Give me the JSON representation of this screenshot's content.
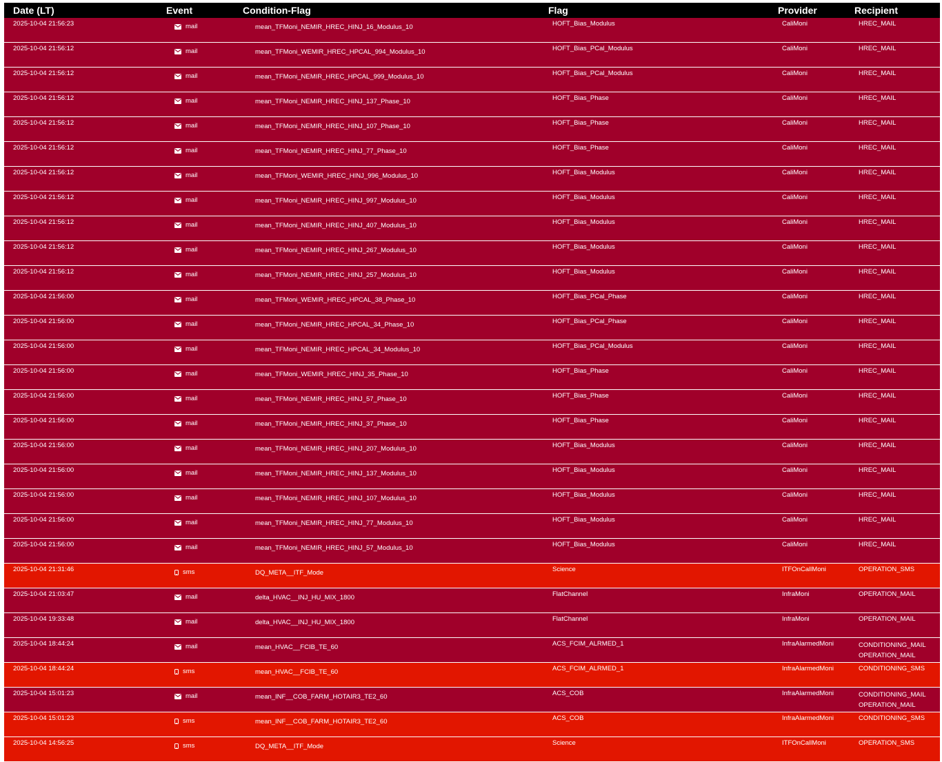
{
  "header": {
    "date": "Date (LT)",
    "event": "Event",
    "condition": "Condition-Flag",
    "flag": "Flag",
    "provider": "Provider",
    "recipient": "Recipient"
  },
  "colors": {
    "header_bg": "#000000",
    "mail_row": "#a0002a",
    "sms_row": "#e21600"
  },
  "rows": [
    {
      "date": "2025-10-04 21:56:23",
      "event": "mail",
      "icon": "envelope-icon",
      "condition": "mean_TFMoni_NEMIR_HREC_HINJ_16_Modulus_10",
      "flag": "HOFT_Bias_Modulus",
      "provider": "CaliMoni",
      "recipient": [
        "HREC_MAIL"
      ]
    },
    {
      "date": "2025-10-04 21:56:12",
      "event": "mail",
      "icon": "envelope-icon",
      "condition": "mean_TFMoni_WEMIR_HREC_HPCAL_994_Modulus_10",
      "flag": "HOFT_Bias_PCal_Modulus",
      "provider": "CaliMoni",
      "recipient": [
        "HREC_MAIL"
      ]
    },
    {
      "date": "2025-10-04 21:56:12",
      "event": "mail",
      "icon": "envelope-icon",
      "condition": "mean_TFMoni_NEMIR_HREC_HPCAL_999_Modulus_10",
      "flag": "HOFT_Bias_PCal_Modulus",
      "provider": "CaliMoni",
      "recipient": [
        "HREC_MAIL"
      ]
    },
    {
      "date": "2025-10-04 21:56:12",
      "event": "mail",
      "icon": "envelope-icon",
      "condition": "mean_TFMoni_NEMIR_HREC_HINJ_137_Phase_10",
      "flag": "HOFT_Bias_Phase",
      "provider": "CaliMoni",
      "recipient": [
        "HREC_MAIL"
      ]
    },
    {
      "date": "2025-10-04 21:56:12",
      "event": "mail",
      "icon": "envelope-icon",
      "condition": "mean_TFMoni_NEMIR_HREC_HINJ_107_Phase_10",
      "flag": "HOFT_Bias_Phase",
      "provider": "CaliMoni",
      "recipient": [
        "HREC_MAIL"
      ]
    },
    {
      "date": "2025-10-04 21:56:12",
      "event": "mail",
      "icon": "envelope-icon",
      "condition": "mean_TFMoni_NEMIR_HREC_HINJ_77_Phase_10",
      "flag": "HOFT_Bias_Phase",
      "provider": "CaliMoni",
      "recipient": [
        "HREC_MAIL"
      ]
    },
    {
      "date": "2025-10-04 21:56:12",
      "event": "mail",
      "icon": "envelope-icon",
      "condition": "mean_TFMoni_WEMIR_HREC_HINJ_996_Modulus_10",
      "flag": "HOFT_Bias_Modulus",
      "provider": "CaliMoni",
      "recipient": [
        "HREC_MAIL"
      ]
    },
    {
      "date": "2025-10-04 21:56:12",
      "event": "mail",
      "icon": "envelope-icon",
      "condition": "mean_TFMoni_NEMIR_HREC_HINJ_997_Modulus_10",
      "flag": "HOFT_Bias_Modulus",
      "provider": "CaliMoni",
      "recipient": [
        "HREC_MAIL"
      ]
    },
    {
      "date": "2025-10-04 21:56:12",
      "event": "mail",
      "icon": "envelope-icon",
      "condition": "mean_TFMoni_NEMIR_HREC_HINJ_407_Modulus_10",
      "flag": "HOFT_Bias_Modulus",
      "provider": "CaliMoni",
      "recipient": [
        "HREC_MAIL"
      ]
    },
    {
      "date": "2025-10-04 21:56:12",
      "event": "mail",
      "icon": "envelope-icon",
      "condition": "mean_TFMoni_NEMIR_HREC_HINJ_267_Modulus_10",
      "flag": "HOFT_Bias_Modulus",
      "provider": "CaliMoni",
      "recipient": [
        "HREC_MAIL"
      ]
    },
    {
      "date": "2025-10-04 21:56:12",
      "event": "mail",
      "icon": "envelope-icon",
      "condition": "mean_TFMoni_NEMIR_HREC_HINJ_257_Modulus_10",
      "flag": "HOFT_Bias_Modulus",
      "provider": "CaliMoni",
      "recipient": [
        "HREC_MAIL"
      ]
    },
    {
      "date": "2025-10-04 21:56:00",
      "event": "mail",
      "icon": "envelope-icon",
      "condition": "mean_TFMoni_WEMIR_HREC_HPCAL_38_Phase_10",
      "flag": "HOFT_Bias_PCal_Phase",
      "provider": "CaliMoni",
      "recipient": [
        "HREC_MAIL"
      ]
    },
    {
      "date": "2025-10-04 21:56:00",
      "event": "mail",
      "icon": "envelope-icon",
      "condition": "mean_TFMoni_NEMIR_HREC_HPCAL_34_Phase_10",
      "flag": "HOFT_Bias_PCal_Phase",
      "provider": "CaliMoni",
      "recipient": [
        "HREC_MAIL"
      ]
    },
    {
      "date": "2025-10-04 21:56:00",
      "event": "mail",
      "icon": "envelope-icon",
      "condition": "mean_TFMoni_NEMIR_HREC_HPCAL_34_Modulus_10",
      "flag": "HOFT_Bias_PCal_Modulus",
      "provider": "CaliMoni",
      "recipient": [
        "HREC_MAIL"
      ]
    },
    {
      "date": "2025-10-04 21:56:00",
      "event": "mail",
      "icon": "envelope-icon",
      "condition": "mean_TFMoni_WEMIR_HREC_HINJ_35_Phase_10",
      "flag": "HOFT_Bias_Phase",
      "provider": "CaliMoni",
      "recipient": [
        "HREC_MAIL"
      ]
    },
    {
      "date": "2025-10-04 21:56:00",
      "event": "mail",
      "icon": "envelope-icon",
      "condition": "mean_TFMoni_NEMIR_HREC_HINJ_57_Phase_10",
      "flag": "HOFT_Bias_Phase",
      "provider": "CaliMoni",
      "recipient": [
        "HREC_MAIL"
      ]
    },
    {
      "date": "2025-10-04 21:56:00",
      "event": "mail",
      "icon": "envelope-icon",
      "condition": "mean_TFMoni_NEMIR_HREC_HINJ_37_Phase_10",
      "flag": "HOFT_Bias_Phase",
      "provider": "CaliMoni",
      "recipient": [
        "HREC_MAIL"
      ]
    },
    {
      "date": "2025-10-04 21:56:00",
      "event": "mail",
      "icon": "envelope-icon",
      "condition": "mean_TFMoni_NEMIR_HREC_HINJ_207_Modulus_10",
      "flag": "HOFT_Bias_Modulus",
      "provider": "CaliMoni",
      "recipient": [
        "HREC_MAIL"
      ]
    },
    {
      "date": "2025-10-04 21:56:00",
      "event": "mail",
      "icon": "envelope-icon",
      "condition": "mean_TFMoni_NEMIR_HREC_HINJ_137_Modulus_10",
      "flag": "HOFT_Bias_Modulus",
      "provider": "CaliMoni",
      "recipient": [
        "HREC_MAIL"
      ]
    },
    {
      "date": "2025-10-04 21:56:00",
      "event": "mail",
      "icon": "envelope-icon",
      "condition": "mean_TFMoni_NEMIR_HREC_HINJ_107_Modulus_10",
      "flag": "HOFT_Bias_Modulus",
      "provider": "CaliMoni",
      "recipient": [
        "HREC_MAIL"
      ]
    },
    {
      "date": "2025-10-04 21:56:00",
      "event": "mail",
      "icon": "envelope-icon",
      "condition": "mean_TFMoni_NEMIR_HREC_HINJ_77_Modulus_10",
      "flag": "HOFT_Bias_Modulus",
      "provider": "CaliMoni",
      "recipient": [
        "HREC_MAIL"
      ]
    },
    {
      "date": "2025-10-04 21:56:00",
      "event": "mail",
      "icon": "envelope-icon",
      "condition": "mean_TFMoni_NEMIR_HREC_HINJ_57_Modulus_10",
      "flag": "HOFT_Bias_Modulus",
      "provider": "CaliMoni",
      "recipient": [
        "HREC_MAIL"
      ]
    },
    {
      "date": "2025-10-04 21:31:46",
      "event": "sms",
      "icon": "mobile-phone-icon",
      "condition": "DQ_META__ITF_Mode",
      "flag": "Science",
      "provider": "ITFOnCallMoni",
      "recipient": [
        "OPERATION_SMS"
      ]
    },
    {
      "date": "2025-10-04 21:03:47",
      "event": "mail",
      "icon": "envelope-icon",
      "condition": "delta_HVAC__INJ_HU_MIX_1800",
      "flag": "FlatChannel",
      "provider": "InfraMoni",
      "recipient": [
        "OPERATION_MAIL"
      ]
    },
    {
      "date": "2025-10-04 19:33:48",
      "event": "mail",
      "icon": "envelope-icon",
      "condition": "delta_HVAC__INJ_HU_MIX_1800",
      "flag": "FlatChannel",
      "provider": "InfraMoni",
      "recipient": [
        "OPERATION_MAIL"
      ]
    },
    {
      "date": "2025-10-04 18:44:24",
      "event": "mail",
      "icon": "envelope-icon",
      "condition": "mean_HVAC__FCIB_TE_60",
      "flag": "ACS_FCIM_ALRMED_1",
      "provider": "InfraAlarmedMoni",
      "recipient": [
        "CONDITIONING_MAIL",
        "OPERATION_MAIL"
      ]
    },
    {
      "date": "2025-10-04 18:44:24",
      "event": "sms",
      "icon": "mobile-phone-icon",
      "condition": "mean_HVAC__FCIB_TE_60",
      "flag": "ACS_FCIM_ALRMED_1",
      "provider": "InfraAlarmedMoni",
      "recipient": [
        "CONDITIONING_SMS"
      ]
    },
    {
      "date": "2025-10-04 15:01:23",
      "event": "mail",
      "icon": "envelope-icon",
      "condition": "mean_INF__COB_FARM_HOTAIR3_TE2_60",
      "flag": "ACS_COB",
      "provider": "InfraAlarmedMoni",
      "recipient": [
        "CONDITIONING_MAIL",
        "OPERATION_MAIL"
      ]
    },
    {
      "date": "2025-10-04 15:01:23",
      "event": "sms",
      "icon": "mobile-phone-icon",
      "condition": "mean_INF__COB_FARM_HOTAIR3_TE2_60",
      "flag": "ACS_COB",
      "provider": "InfraAlarmedMoni",
      "recipient": [
        "CONDITIONING_SMS"
      ]
    },
    {
      "date": "2025-10-04 14:56:25",
      "event": "sms",
      "icon": "mobile-phone-icon",
      "condition": "DQ_META__ITF_Mode",
      "flag": "Science",
      "provider": "ITFOnCallMoni",
      "recipient": [
        "OPERATION_SMS"
      ]
    }
  ]
}
